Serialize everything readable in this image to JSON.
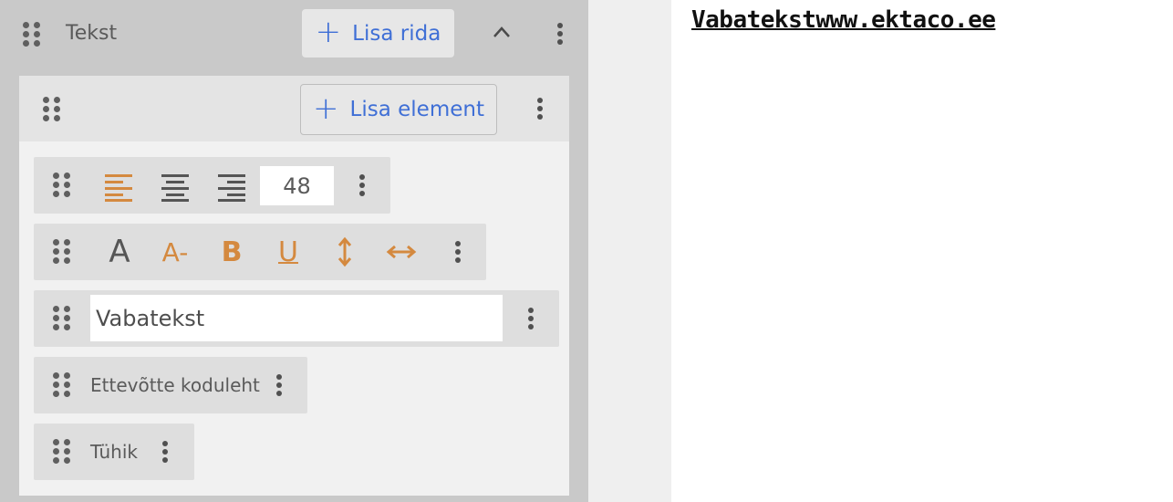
{
  "row": {
    "title": "Tekst",
    "add_row_label": "Lisa rida"
  },
  "element": {
    "add_element_label": "Lisa element"
  },
  "alignment_toolbar": {
    "font_size_value": "48",
    "icons": [
      "align-left-icon",
      "align-center-icon",
      "align-right-icon"
    ],
    "active_icon": "align-left-icon"
  },
  "style_toolbar": {
    "icons": [
      "font-icon",
      "font-size-decrease-icon",
      "bold-icon",
      "underline-icon",
      "vertical-spacing-icon",
      "horizontal-spacing-icon"
    ],
    "font_glyph": "A",
    "decrease_glyph": "A-",
    "bold_glyph": "B",
    "underline_glyph": "U"
  },
  "text_block": {
    "value": "Vabatekst"
  },
  "items": [
    {
      "label": "Ettevõtte koduleht"
    },
    {
      "label": "Tühik"
    }
  ],
  "preview": {
    "text": "Vabatekstwww.ektaco.ee"
  },
  "colors": {
    "accent_blue": "#3f6fd6",
    "accent_orange": "#d4893f",
    "panel_bg": "#c9c9c9"
  }
}
